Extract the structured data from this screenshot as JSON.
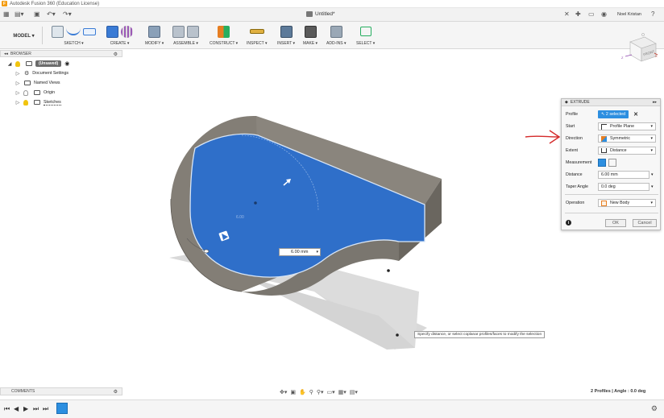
{
  "titlebar": {
    "title": "Autodesk Fusion 360 (Education License)"
  },
  "tabbar": {
    "document_tab": "Untitled*",
    "user": "Noel Kristan"
  },
  "toolbar": {
    "workspace": "MODEL ▾",
    "groups": [
      {
        "label": "SKETCH ▾"
      },
      {
        "label": "CREATE ▾"
      },
      {
        "label": "MODIFY ▾"
      },
      {
        "label": "ASSEMBLE ▾"
      },
      {
        "label": "CONSTRUCT ▾"
      },
      {
        "label": "INSPECT ▾"
      },
      {
        "label": "INSERT ▾"
      },
      {
        "label": "MAKE ▾"
      },
      {
        "label": "ADD-INS ▾"
      },
      {
        "label": "SELECT ▾"
      }
    ]
  },
  "browser": {
    "header": "BROWSER",
    "root": "(Unsaved)",
    "items": [
      {
        "label": "Document Settings"
      },
      {
        "label": "Named Views"
      },
      {
        "label": "Origin"
      },
      {
        "label": "Sketches"
      }
    ]
  },
  "viewcube": {
    "face": "FRONT"
  },
  "extrude": {
    "header": "EXTRUDE",
    "profile_label": "Profile",
    "profile_value": "2 selected",
    "start_label": "Start",
    "start_value": "Profile Plane",
    "direction_label": "Direction",
    "direction_value": "Symmetric",
    "extent_label": "Extent",
    "extent_value": "Distance",
    "measurement_label": "Measurement",
    "distance_label": "Distance",
    "distance_value": "6.00 mm",
    "taper_label": "Taper Angle",
    "taper_value": "0.0 deg",
    "operation_label": "Operation",
    "operation_value": "New Body",
    "ok": "OK",
    "cancel": "Cancel"
  },
  "viewport": {
    "dimension_value": "6.00 mm",
    "tooltip": "Specify distance, or select coplanar profiles/faces to modify the selection"
  },
  "comments": {
    "label": "COMMENTS"
  },
  "status": {
    "right": "2 Profiles | Angle : 0.0 deg"
  },
  "colors": {
    "accent": "#2d8fe0",
    "body_gray": "#7a766f",
    "selection_blue": "#2f6fc9",
    "annotation_red": "#d42a2a"
  }
}
